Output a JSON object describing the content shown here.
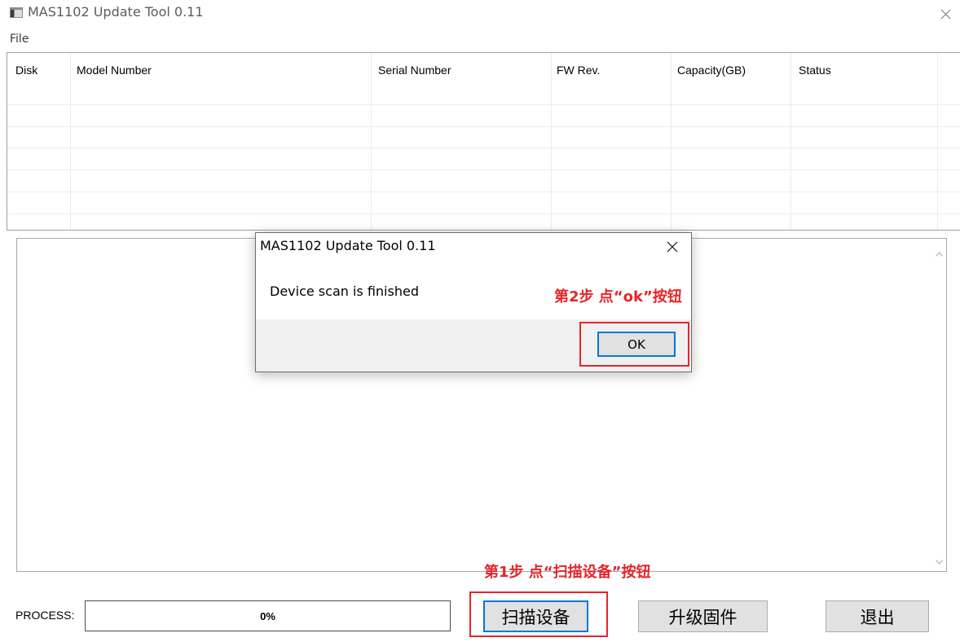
{
  "window": {
    "title": "MAS1102 Update Tool 0.11",
    "app_icon": "app-window-icon",
    "close_icon": "close-icon"
  },
  "menu": {
    "items": [
      {
        "label": "File"
      }
    ]
  },
  "table": {
    "columns": [
      "Disk",
      "Model Number",
      "Serial Number",
      "FW Rev.",
      "Capacity(GB)",
      "Status"
    ]
  },
  "log": {
    "scroll_up_icon": "chevron-up-icon",
    "scroll_down_icon": "chevron-down-icon"
  },
  "dialog": {
    "title": "MAS1102 Update Tool 0.11",
    "message": "Device scan is finished",
    "ok_label": "OK",
    "close_icon": "close-icon"
  },
  "annotations": {
    "step2": "第2步 点“ok”按钮",
    "step1": "第1步 点“扫描设备”按钮"
  },
  "process": {
    "label": "PROCESS:",
    "value_text": "0%",
    "progress_percent": 0
  },
  "buttons": {
    "scan": "扫描设备",
    "upgrade": "升级固件",
    "exit": "退出"
  },
  "colors": {
    "annotation_red": "#e3262b",
    "focus_blue": "#0078d7",
    "button_face": "#e1e1e1",
    "dialog_footer": "#f0f0f0"
  }
}
